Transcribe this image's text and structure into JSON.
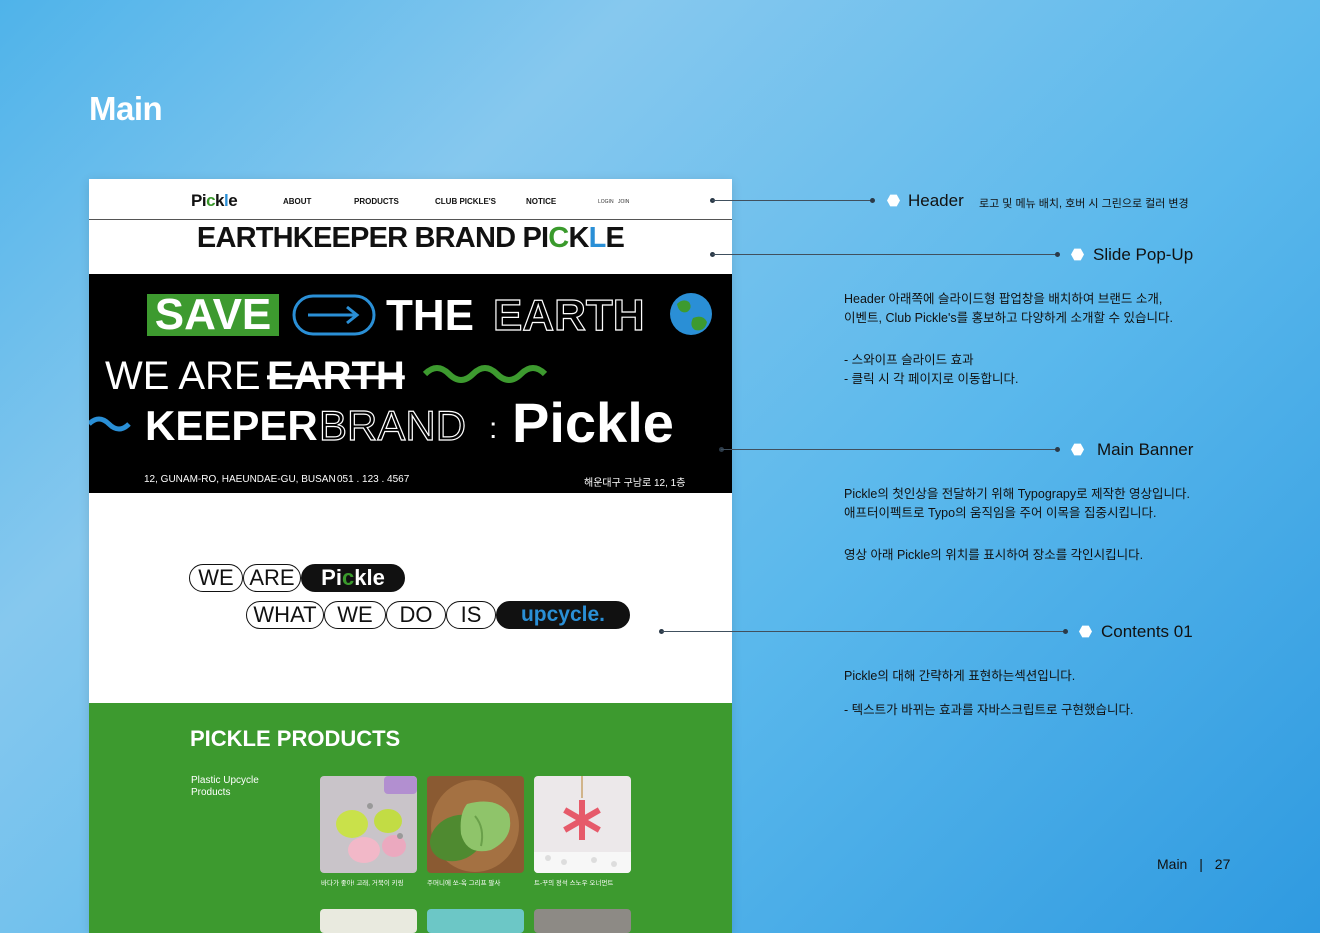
{
  "page_title": "Main",
  "mockup": {
    "header": {
      "logo": {
        "p1": "Pi",
        "c": "c",
        "k": "k",
        "l": "l",
        "e": "e"
      },
      "nav": [
        "ABOUT",
        "PRODUCTS",
        "CLUB PICKLE'S",
        "NOTICE"
      ],
      "login": "LOGIN",
      "join": "JOIN"
    },
    "brand_line": {
      "part1": "EARTHKEEPER BRAND PI",
      "c": "C",
      "k": "K",
      "l": "L",
      "e": "E"
    },
    "banner": {
      "save": "SAVE",
      "the": "THE",
      "earth": "EARTH",
      "we_are": "WE ARE",
      "earth2": "EARTH",
      "keeper": "KEEPER",
      "brand": "BRAND",
      "colon": ":",
      "pickle": "Pickle",
      "address": "12, GUNAM-RO, HAEUNDAE-GU, BUSAN",
      "phone": "051 . 123 . 4567",
      "address_kr": "해운대구  구남로 12, 1층"
    },
    "contents01": {
      "row1": [
        "WE",
        "ARE"
      ],
      "row1_brand": {
        "p1": "Pi",
        "c": "c",
        "k": "kle"
      },
      "row2": [
        "WHAT",
        "WE",
        "DO",
        "IS"
      ],
      "row2_highlight": "upcycle."
    },
    "products": {
      "title": "PICKLE PRODUCTS",
      "subtitle": "Plastic Upcycle Products",
      "items": [
        {
          "caption": "바다가 좋아! 고래, 거북이 키링"
        },
        {
          "caption": "주머니에 쏘-옥 그리프 팔사"
        },
        {
          "caption": "트-꾸의 정석 스노우 오너먼트"
        }
      ]
    }
  },
  "annotations": {
    "header": {
      "title": "Header",
      "desc": "로고 및 메뉴 배치, 호버 시 그린으로 컬러 변경"
    },
    "slide": {
      "title": "Slide Pop-Up",
      "lines": [
        "Header 아래쪽에 슬라이드형 팝업창을 배치하여 브랜드 소개,",
        "이벤트, Club Pickle's를 홍보하고 다양하게 소개할 수 있습니다.",
        "- 스와이프 슬라이드 효과",
        "- 클릭 시 각 페이지로 이동합니다."
      ]
    },
    "banner": {
      "title": "Main Banner",
      "lines": [
        "Pickle의 첫인상을 전달하기 위해 Typograpy로 제작한 영상입니다.",
        "애프터이펙트로 Typo의 움직임을 주어 이목을 집중시킵니다.",
        "영상 아래 Pickle의 위치를 표시하여  장소를 각인시킵니다."
      ]
    },
    "contents": {
      "title": "Contents 01",
      "lines": [
        "Pickle의 대해 간략하게 표현하는섹션입니다.",
        "- 텍스트가 바뀌는 효과를 자바스크립트로 구현했습니다."
      ]
    }
  },
  "footer": {
    "section": "Main",
    "sep": "|",
    "page": "27"
  },
  "colors": {
    "green": "#3d9a2f",
    "blue": "#2a8fd6",
    "black": "#000000"
  }
}
